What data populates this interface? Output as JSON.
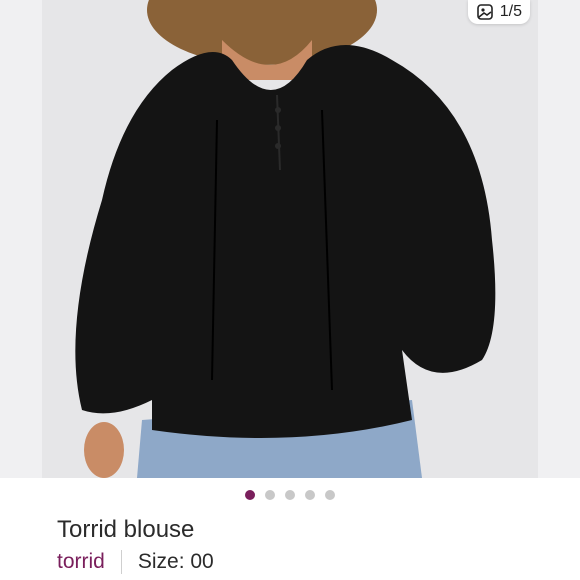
{
  "photo": {
    "counter": "1/5",
    "icon": "image-icon"
  },
  "carousel": {
    "dots": [
      true,
      false,
      false,
      false,
      false
    ],
    "active_color": "#7a1f5c",
    "inactive_color": "#c8c8c8"
  },
  "listing": {
    "title": "Torrid blouse",
    "brand": "torrid",
    "size": "Size: 00",
    "brand_color": "#7a1f5c"
  }
}
